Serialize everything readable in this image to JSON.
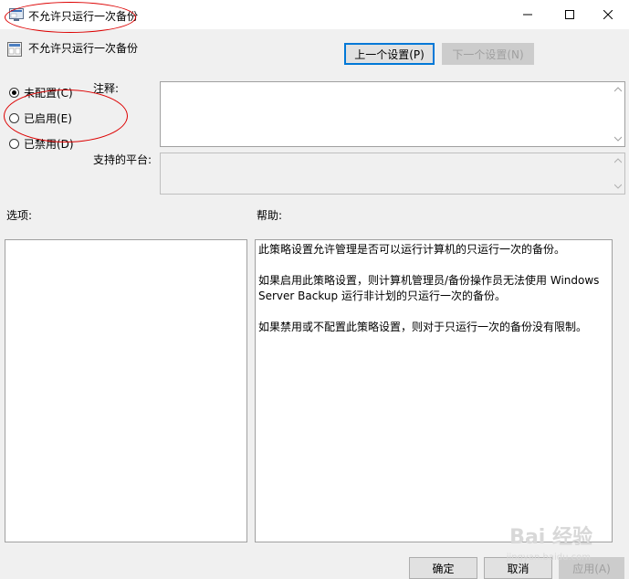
{
  "window": {
    "title": "不允许只运行一次备份"
  },
  "header": {
    "policy_name": "不允许只运行一次备份",
    "prev_button": "上一个设置(P)",
    "next_button": "下一个设置(N)"
  },
  "state": {
    "options": [
      {
        "label": "未配置(C)",
        "checked": true
      },
      {
        "label": "已启用(E)",
        "checked": false
      },
      {
        "label": "已禁用(D)",
        "checked": false
      }
    ]
  },
  "fields": {
    "comment_label": "注释:",
    "comment_value": "",
    "platform_label": "支持的平台:",
    "platform_value": ""
  },
  "sections": {
    "options_label": "选项:",
    "help_label": "帮助:"
  },
  "help": {
    "paragraphs": [
      "此策略设置允许管理是否可以运行计算机的只运行一次的备份。",
      "如果启用此策略设置，则计算机管理员/备份操作员无法使用 Windows Server Backup 运行非计划的只运行一次的备份。",
      "如果禁用或不配置此策略设置，则对于只运行一次的备份没有限制。"
    ]
  },
  "footer": {
    "ok": "确定",
    "cancel": "取消",
    "apply": "应用(A)"
  },
  "watermark": {
    "brand": "Bai 经验",
    "url": "jingyan.baidu.com"
  },
  "colors": {
    "accent": "#0078d7",
    "annotation": "#dd0000"
  }
}
